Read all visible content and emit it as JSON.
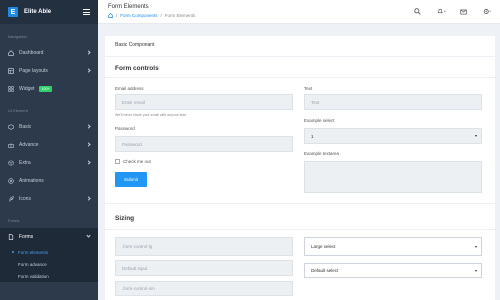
{
  "brand": {
    "logo_letter": "E",
    "name": "Elite Able"
  },
  "sidebar": {
    "sections": {
      "navigation": "Navigation",
      "ui_element": "UI Element",
      "forms": "Forms"
    },
    "items": [
      {
        "label": "Dashboard",
        "icon": "home-icon"
      },
      {
        "label": "Page layouts",
        "icon": "layout-icon"
      },
      {
        "label": "Widget",
        "icon": "widget-icon",
        "badge": "100+"
      },
      {
        "label": "Basic",
        "icon": "box-icon"
      },
      {
        "label": "Advance",
        "icon": "gift-icon"
      },
      {
        "label": "Extra",
        "icon": "package-icon"
      },
      {
        "label": "Animations",
        "icon": "aperture-icon"
      },
      {
        "label": "Icons",
        "icon": "feather-icon"
      },
      {
        "label": "Forms",
        "icon": "file-icon"
      }
    ],
    "sub_items": [
      {
        "label": "Form elements"
      },
      {
        "label": "Form advance"
      },
      {
        "label": "Form validation"
      }
    ]
  },
  "header": {
    "title": "Form Elements",
    "breadcrumb": [
      "Form Components",
      "Form Elements"
    ],
    "separator": "/"
  },
  "card": {
    "title": "Basic Componant",
    "form_controls": {
      "heading": "Form controls",
      "email_label": "Email address",
      "email_placeholder": "Enter email",
      "email_help": "We'll never share your email with anyone else.",
      "password_label": "Password",
      "password_placeholder": "Password",
      "checkbox_label": "Check me out",
      "submit_label": "Submit",
      "text_label": "Text",
      "text_placeholder": "Text",
      "select_label": "Example select",
      "select_value": "1",
      "textarea_label": "Example textarea"
    },
    "sizing": {
      "heading": "Sizing",
      "lg_placeholder": ".form-control-lg",
      "default_placeholder": "Default input",
      "sm_placeholder": ".form-control-sm",
      "large_select": "Large select",
      "default_select": "Default select"
    }
  },
  "colors": {
    "sidebar_bg": "#2d3a4b",
    "accent": "#2196f3",
    "badge": "#2ed16b"
  }
}
